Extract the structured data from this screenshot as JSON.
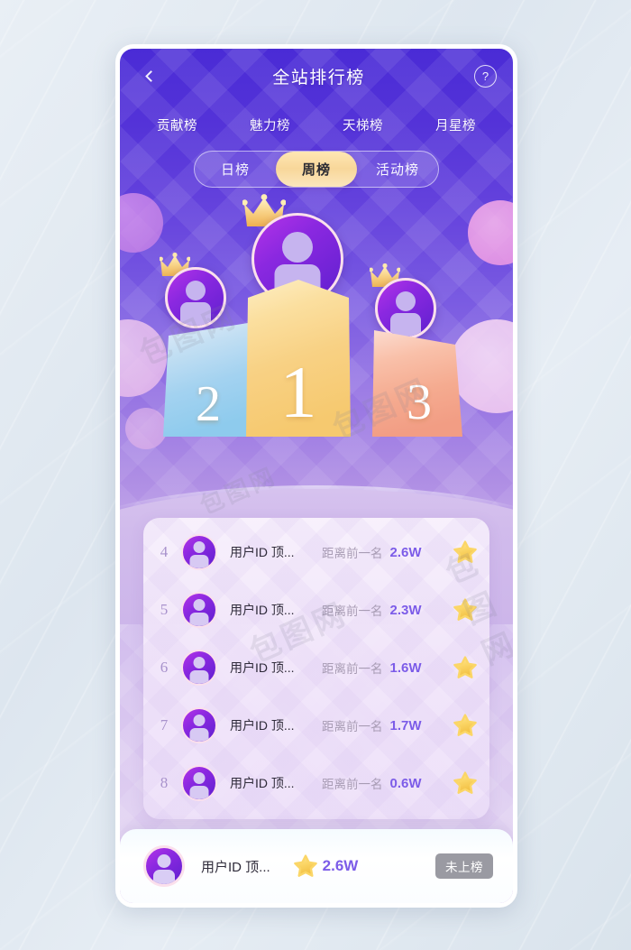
{
  "header": {
    "back_icon": "chevron-left-icon",
    "title": "全站排行榜",
    "help_icon": "?"
  },
  "category_tabs": [
    {
      "label": "贡献榜",
      "active": true
    },
    {
      "label": "魅力榜",
      "active": false
    },
    {
      "label": "天梯榜",
      "active": false
    },
    {
      "label": "月星榜",
      "active": false
    }
  ],
  "period_segments": [
    {
      "label": "日榜",
      "active": false
    },
    {
      "label": "周榜",
      "active": true
    },
    {
      "label": "活动榜",
      "active": false
    }
  ],
  "podium": [
    {
      "rank": "1",
      "position": "center",
      "crown": "crown-icon",
      "avatar": "user-avatar-icon"
    },
    {
      "rank": "2",
      "position": "left",
      "crown": "crown-icon",
      "avatar": "user-avatar-icon"
    },
    {
      "rank": "3",
      "position": "right",
      "crown": "crown-icon",
      "avatar": "user-avatar-icon"
    }
  ],
  "list": {
    "gap_label": "距离前一名",
    "rows": [
      {
        "rank": "4",
        "name": "用户ID 顶...",
        "gap_label": "距离前一名",
        "gap_value": "2.6W",
        "star_icon": "star-icon"
      },
      {
        "rank": "5",
        "name": "用户ID 顶...",
        "gap_label": "距离前一名",
        "gap_value": "2.3W",
        "star_icon": "star-icon"
      },
      {
        "rank": "6",
        "name": "用户ID 顶...",
        "gap_label": "距离前一名",
        "gap_value": "1.6W",
        "star_icon": "star-icon"
      },
      {
        "rank": "7",
        "name": "用户ID 顶...",
        "gap_label": "距离前一名",
        "gap_value": "1.7W",
        "star_icon": "star-icon"
      },
      {
        "rank": "8",
        "name": "用户ID 顶...",
        "gap_label": "距离前一名",
        "gap_value": "0.6W",
        "star_icon": "star-icon"
      }
    ]
  },
  "self_bar": {
    "avatar": "user-avatar-icon",
    "name": "用户ID 顶...",
    "star_icon": "star-icon",
    "value": "2.6W",
    "status_badge": "未上榜"
  },
  "watermarks": {
    "a": "包图网",
    "b": "包图网",
    "c": "包图网",
    "d": "包图网",
    "e": "包图网"
  },
  "colors": {
    "header_purple": "#4a2bd6",
    "mid_purple": "#9573e3",
    "light_lavender": "#cdb3ec",
    "accent_purple": "#7c5ce8",
    "gold": "#f8d79a",
    "star_gold": "#fbd767",
    "podium_1": "#f6d98f",
    "podium_2": "#9ed2ef",
    "podium_3": "#f4a98d",
    "badge_gray": "#9a9aa2"
  }
}
